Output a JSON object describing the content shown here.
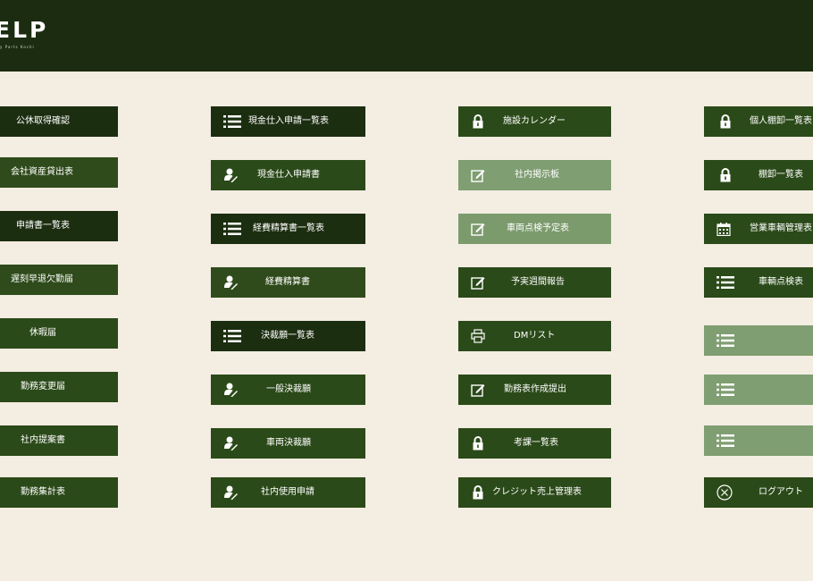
{
  "header": {
    "logo": "ELP",
    "logo_sub": "y Parts Kochi"
  },
  "columns": [
    {
      "items": [
        {
          "label": "公休取得確認"
        },
        {
          "label": "会社資産貸出表"
        },
        {
          "label": "申請書一覧表"
        },
        {
          "label": "遅刻早退欠勤届"
        },
        {
          "label": "休暇届"
        },
        {
          "label": "勤務変更届"
        },
        {
          "label": "社内提案書"
        },
        {
          "label": "勤務集計表"
        }
      ]
    },
    {
      "items": [
        {
          "label": "現金仕入申請一覧表",
          "icon": "list-icon"
        },
        {
          "label": "現金仕入申請書",
          "icon": "person-edit-icon"
        },
        {
          "label": "経費精算書一覧表",
          "icon": "list-icon"
        },
        {
          "label": "経費精算書",
          "icon": "person-edit-icon"
        },
        {
          "label": "決裁願一覧表",
          "icon": "list-icon"
        },
        {
          "label": "一般決裁願",
          "icon": "person-edit-icon"
        },
        {
          "label": "車両決裁願",
          "icon": "person-edit-icon"
        },
        {
          "label": "社内使用申請",
          "icon": "person-edit-icon"
        }
      ]
    },
    {
      "items": [
        {
          "label": "施設カレンダー",
          "icon": "lock-icon"
        },
        {
          "label": "社内掲示板",
          "icon": "edit-note-icon"
        },
        {
          "label": "車両点検予定表",
          "icon": "edit-note-icon"
        },
        {
          "label": "予実週間報告",
          "icon": "edit-note-icon"
        },
        {
          "label": "DMリスト",
          "icon": "printer-icon"
        },
        {
          "label": "勤務表作成提出",
          "icon": "edit-note-icon"
        },
        {
          "label": "考課一覧表",
          "icon": "lock-icon"
        },
        {
          "label": "クレジット売上管理表",
          "icon": "lock-icon"
        }
      ]
    },
    {
      "items": [
        {
          "label": "個人棚卸一覧表",
          "icon": "lock-icon"
        },
        {
          "label": "棚卸一覧表",
          "icon": "lock-icon"
        },
        {
          "label": "営業車輌管理表",
          "icon": "calendar-icon"
        },
        {
          "label": "車輌点検表",
          "icon": "list-icon"
        },
        {
          "label": "",
          "icon": "list-icon"
        },
        {
          "label": "",
          "icon": "list-icon"
        },
        {
          "label": "",
          "icon": "list-icon"
        },
        {
          "label": "ログアウト",
          "icon": "logout-circle-x-icon"
        }
      ]
    }
  ],
  "colors": {
    "header_bg": "#1b2c10",
    "page_bg": "#f3ede2",
    "button_dark": "#1c2e10",
    "button_mid": "#2f4b1b",
    "button_light": "#7f9e72"
  }
}
